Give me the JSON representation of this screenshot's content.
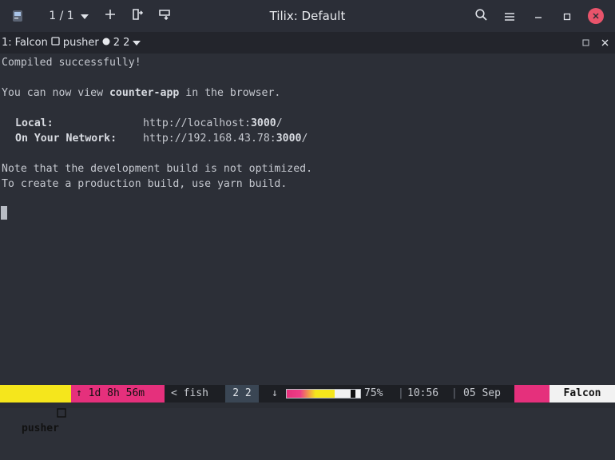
{
  "titlebar": {
    "title": "Tilix: Default",
    "session_counter": "1 / 1",
    "icons": [
      "terminal-app-icon",
      "chevron-down-icon",
      "add-icon",
      "split-right-icon",
      "split-down-icon",
      "search-icon",
      "hamburger-menu-icon",
      "minimize-icon",
      "maximize-icon",
      "close-icon"
    ]
  },
  "session": {
    "number": "1:",
    "host": "Falcon",
    "name": "pusher",
    "counts": "2 2",
    "icons": [
      "window-icon",
      "dot-icon",
      "chevron-down-icon",
      "maximize-pane-icon",
      "close-pane-icon"
    ]
  },
  "terminal": {
    "lines": [
      "Compiled successfully!",
      "You can now view ",
      "counter-app",
      " in the browser."
    ],
    "local_label": "Local:",
    "local_url_prefix": "http://localhost:",
    "local_port": "3000",
    "local_url_suffix": "/",
    "network_label": "On Your Network:",
    "network_url_prefix": "http://192.168.43.78:",
    "network_port": "3000",
    "network_url_suffix": "/",
    "note1": "Note that the development build is not optimized.",
    "note2": "To create a production build, use yarn build."
  },
  "statusbar": {
    "session": "pusher",
    "uptime": "↑ 1d 8h 56m",
    "window": "< fish",
    "panes": "2 2",
    "download_arrow": "↓",
    "battery_percent": "75%",
    "battery_level": 0.75,
    "time": "10:56",
    "date": "05 Sep",
    "host": "Falcon"
  },
  "colors": {
    "session_segment": "#f5e61c",
    "uptime_segment": "#e5307c",
    "host_segment": "#f2f2f2",
    "terminal_bg": "#2c2f37",
    "close_button": "#e9546b"
  }
}
